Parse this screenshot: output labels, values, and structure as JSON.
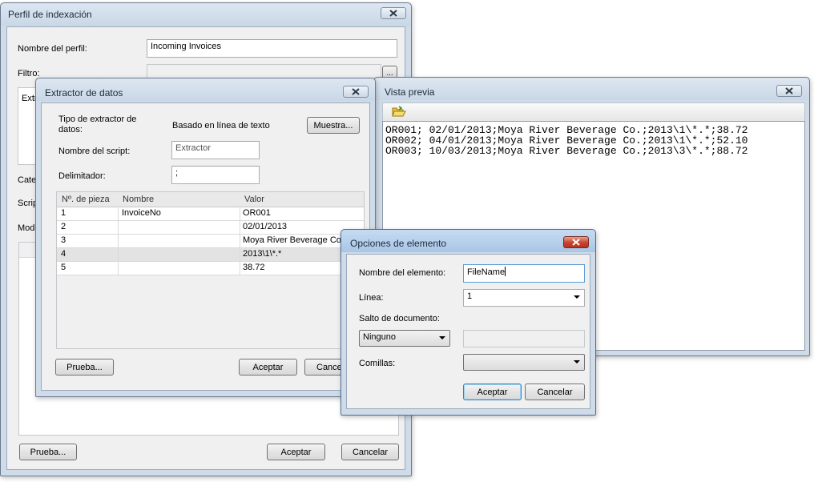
{
  "perfil": {
    "title": "Perfil de indexación",
    "nombre_label": "Nombre del perfil:",
    "nombre_value": "Incoming Invoices",
    "filtro_label": "Filtro:",
    "filtro_button": "...",
    "extr_label": "Extr",
    "cate_label": "Cate",
    "scrip_label": "Scrip",
    "modo_label": "Modo",
    "prueba_button": "Prueba...",
    "aceptar_button": "Aceptar",
    "cancelar_button": "Cancelar"
  },
  "extractor": {
    "title": "Extractor de datos",
    "tipo_label_1": "Tipo de extractor de",
    "tipo_label_2": "datos:",
    "tipo_value": "Basado en línea de texto",
    "muestra_button": "Muestra...",
    "script_label": "Nombre del script:",
    "script_value": "Extractor",
    "delim_label": "Delimitador:",
    "delim_value": ";",
    "columns": [
      "Nº. de pieza",
      "Nombre",
      "Valor"
    ],
    "rows": [
      [
        "1",
        "InvoiceNo",
        "OR001"
      ],
      [
        "2",
        "",
        "02/01/2013"
      ],
      [
        "3",
        "",
        "Moya River Beverage Co."
      ],
      [
        "4",
        "",
        "2013\\1\\*.*"
      ],
      [
        "5",
        "",
        "38.72"
      ]
    ],
    "prueba_button": "Prueba...",
    "aceptar_button": "Aceptar",
    "cancelar_button": "Cancel"
  },
  "preview": {
    "title": "Vista previa",
    "lines": [
      "OR001; 02/01/2013;Moya River Beverage Co.;2013\\1\\*.*;38.72",
      "OR002; 04/01/2013;Moya River Beverage Co.;2013\\1\\*.*;52.10",
      "OR003; 10/03/2013;Moya River Beverage Co.;2013\\3\\*.*;88.72"
    ]
  },
  "opciones": {
    "title": "Opciones de elemento",
    "nombre_label": "Nombre del elemento:",
    "nombre_value": "FileName",
    "linea_label": "Línea:",
    "linea_value": "1",
    "salto_label": "Salto de documento:",
    "salto_value": "Ninguno",
    "comillas_label": "Comillas:",
    "comillas_value": "",
    "aceptar_button": "Aceptar",
    "cancelar_button": "Cancelar"
  }
}
